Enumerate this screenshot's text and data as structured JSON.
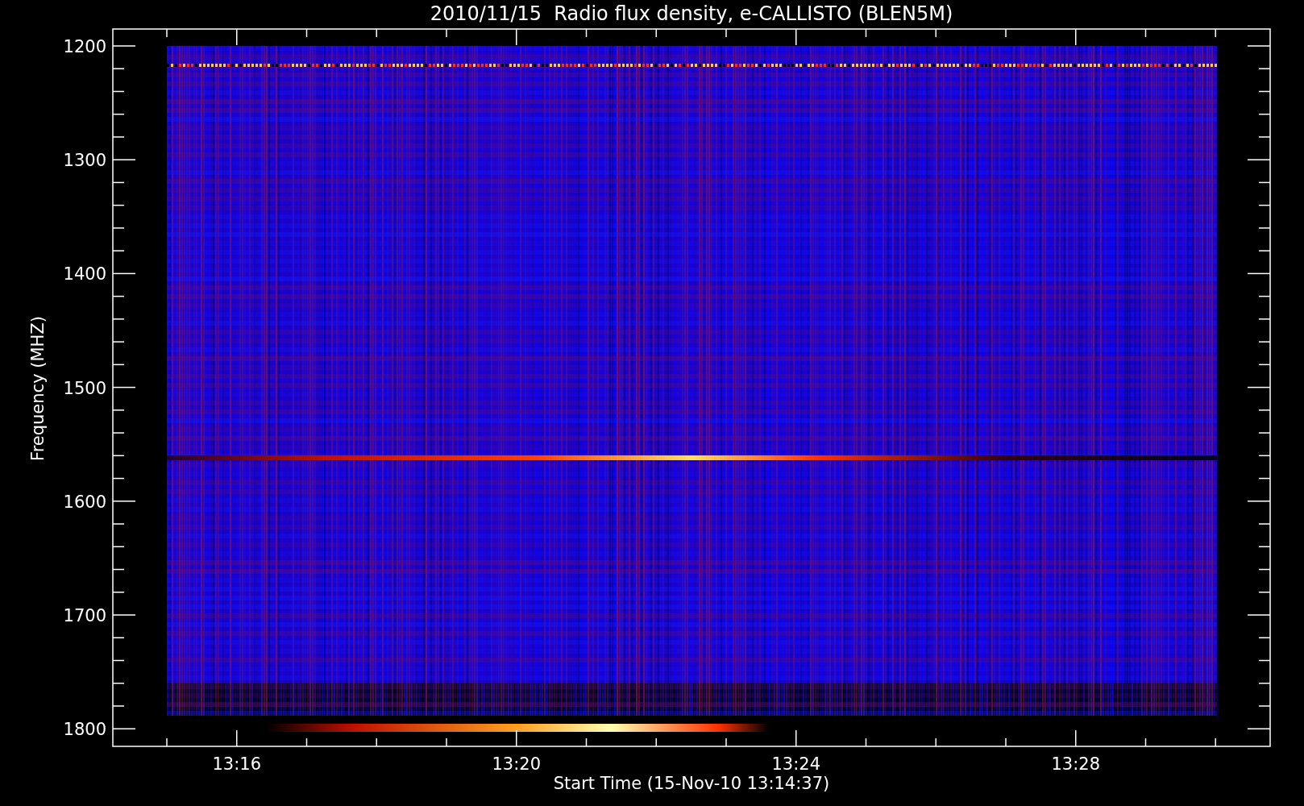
{
  "title": "2010/11/15  Radio flux density, e-CALLISTO (BLEN5M)",
  "ylabel": "Frequency (MHZ)",
  "xlabel": "Start Time (15-Nov-10 13:14:37)",
  "yticks": [
    "1200",
    "1300",
    "1400",
    "1500",
    "1600",
    "1700",
    "1800"
  ],
  "xticks": [
    "13:16",
    "13:20",
    "13:24",
    "13:28"
  ]
}
